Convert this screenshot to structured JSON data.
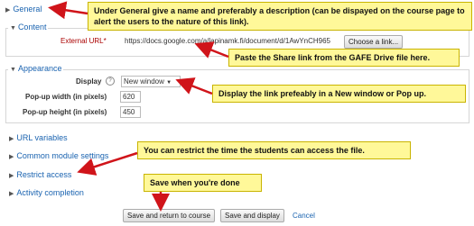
{
  "sections": {
    "general": "General",
    "content": "Content",
    "appearance": "Appearance",
    "url_variables": "URL variables",
    "common_module_settings": "Common module settings",
    "restrict_access": "Restrict access",
    "activity_completion": "Activity completion"
  },
  "content": {
    "external_url_label": "External URL",
    "required_mark": "*",
    "external_url_value": "https://docs.google.com/a/lapinamk.fi/document/d/1AwYnCH965",
    "choose_link_button": "Choose a link..."
  },
  "appearance": {
    "display_label": "Display",
    "display_value": "New window",
    "popup_width_label": "Pop-up width (in pixels)",
    "popup_width_value": "620",
    "popup_height_label": "Pop-up height (in pixels)",
    "popup_height_value": "450"
  },
  "actions": {
    "save_return": "Save and return to course",
    "save_display": "Save and display",
    "cancel": "Cancel"
  },
  "callouts": {
    "general": "Under General give a name and preferably a description (can be dispayed on the course page to alert the users to the nature of this link).",
    "paste": "Paste the Share link from the GAFE Drive file here.",
    "display": "Display the link prefeably in a New window or Pop up.",
    "restrict": "You can restrict the time the students can access the file.",
    "save": "Save when you're done"
  },
  "colors": {
    "callout_bg": "#fff899",
    "arrow": "#d0141a",
    "link": "#1a63b0"
  }
}
